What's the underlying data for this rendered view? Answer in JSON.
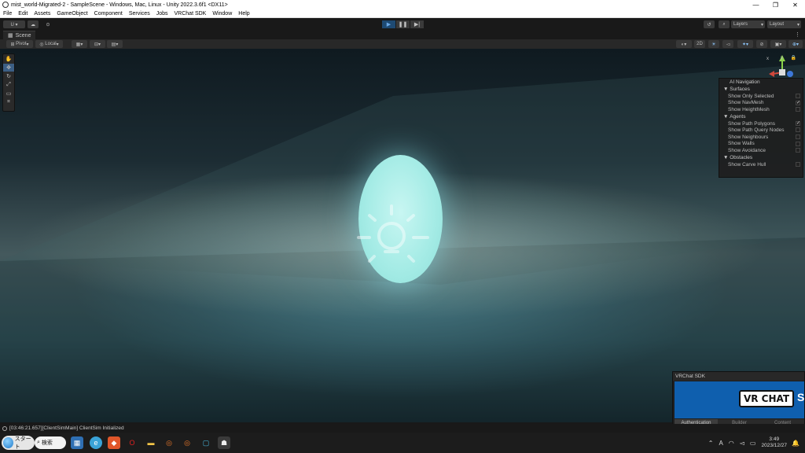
{
  "window": {
    "title": "mist_world-Migrated-2 - SampleScene - Windows, Mac, Linux - Unity 2022.3.6f1 <DX11>",
    "controls": [
      "—",
      "❐",
      "✕"
    ]
  },
  "menu": [
    "File",
    "Edit",
    "Assets",
    "GameObject",
    "Component",
    "Services",
    "Jobs",
    "VRChat SDK",
    "Window",
    "Help"
  ],
  "toolbar": {
    "account_label": "U ▾",
    "layers_label": "Layers",
    "layout_label": "Layout"
  },
  "scene_tab": {
    "label": "Scene"
  },
  "scene_toolbar": {
    "pivot_label": "Pivot",
    "local_label": "Local",
    "mode_2d_label": "2D"
  },
  "gizmo": {
    "x_label": "x",
    "y_label": "y"
  },
  "ai_navigation": {
    "title": "AI Navigation",
    "sections": [
      {
        "name": "Surfaces",
        "options": [
          {
            "label": "Show Only Selected",
            "checked": false
          },
          {
            "label": "Show NavMesh",
            "checked": true
          },
          {
            "label": "Show HeightMesh",
            "checked": false
          }
        ]
      },
      {
        "name": "Agents",
        "options": [
          {
            "label": "Show Path Polygons",
            "checked": true
          },
          {
            "label": "Show Path Query Nodes",
            "checked": false
          },
          {
            "label": "Show Neighbours",
            "checked": false
          },
          {
            "label": "Show Walls",
            "checked": false
          },
          {
            "label": "Show Avoidance",
            "checked": false
          }
        ]
      },
      {
        "name": "Obstacles",
        "options": [
          {
            "label": "Show Carve Hull",
            "checked": false
          }
        ]
      }
    ]
  },
  "vrchat_panel": {
    "title": "VRChat SDK",
    "logo_text": "VR CHAT",
    "logo_trailing": "S",
    "tabs": [
      {
        "label": "Authentication",
        "active": true
      },
      {
        "label": "Builder",
        "active": false
      },
      {
        "label": "Content",
        "active": false
      }
    ]
  },
  "console": {
    "message": "[03:46:21.657][ClientSimMain] ClientSim Initialized"
  },
  "taskbar": {
    "start_label": "スタート",
    "search_label": "検索",
    "ime_label": "A",
    "time": "3:49",
    "date": "2023/12/27"
  }
}
